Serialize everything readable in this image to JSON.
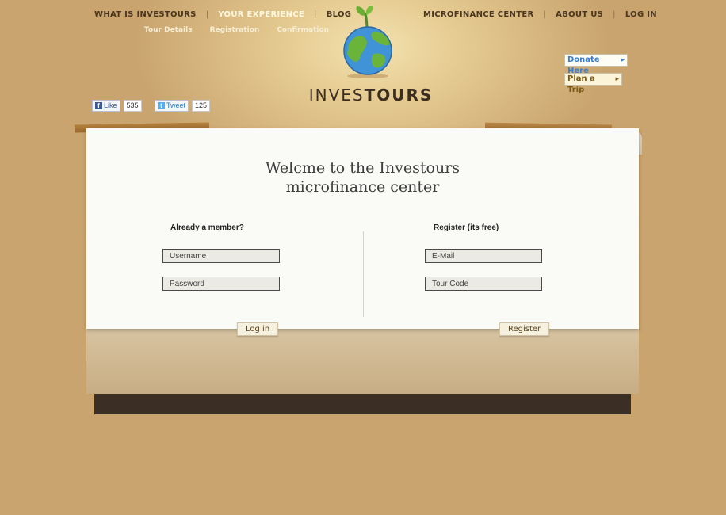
{
  "nav": {
    "left": [
      "WHAT IS INVESTOURS",
      "YOUR EXPERIENCE",
      "BLOG"
    ],
    "right": [
      "MICROFINANCE CENTER",
      "ABOUT US",
      "LOG IN"
    ],
    "sub": [
      "Tour Details",
      "Registration",
      "Confirmation"
    ]
  },
  "logo": {
    "light": "INVES",
    "bold": "TOURS"
  },
  "side_buttons": {
    "donate": "Donate Here",
    "plan": "Plan a Trip"
  },
  "social": {
    "like_label": "Like",
    "like_count": "535",
    "tweet_label": "Tweet",
    "tweet_count": "125"
  },
  "card": {
    "title_line1": "Welcme to the Investours",
    "title_line2": "microfinance center",
    "login": {
      "heading": "Already a member?",
      "username_placeholder": "Username",
      "password_placeholder": "Password",
      "button": "Log in"
    },
    "register": {
      "heading": "Register (its free)",
      "email_placeholder": "E-Mail",
      "tourcode_placeholder": "Tour Code",
      "button": "Register"
    }
  },
  "colors": {
    "background": "#c9a46e",
    "donate_text": "#3b7fc9",
    "plan_text": "#7a5a17"
  }
}
